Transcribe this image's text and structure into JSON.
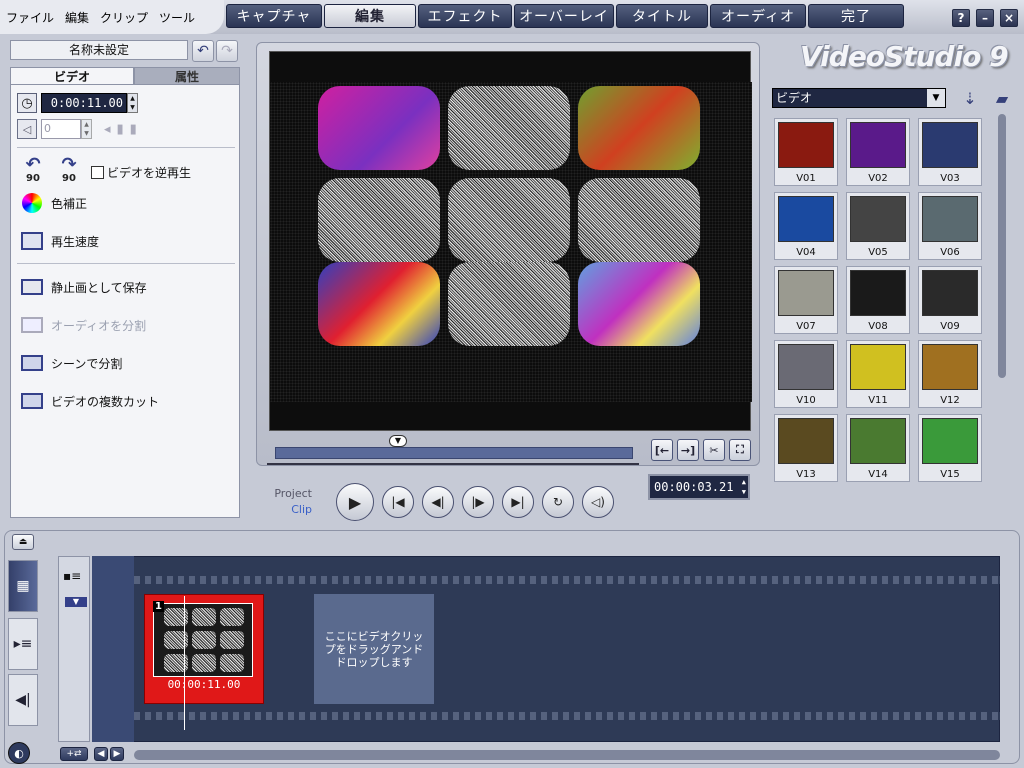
{
  "menu": [
    "ファイル",
    "編集",
    "クリップ",
    "ツール"
  ],
  "tabs": [
    {
      "label": "キャプチャ",
      "active": false
    },
    {
      "label": "編集",
      "active": true
    },
    {
      "label": "エフェクト",
      "active": false
    },
    {
      "label": "オーバーレイ",
      "active": false
    },
    {
      "label": "タイトル",
      "active": false
    },
    {
      "label": "オーディオ",
      "active": false
    },
    {
      "label": "完了",
      "active": false
    }
  ],
  "window_controls": [
    "?",
    "–",
    "×"
  ],
  "project_name": "名称未設定",
  "panel_tabs": {
    "video": "ビデオ",
    "attributes": "属性"
  },
  "options": {
    "duration": "0:00:11.00",
    "volume_value": "0",
    "rotate_left_label": "90",
    "rotate_right_label": "90",
    "reverse_label": "ビデオを逆再生",
    "reverse_checked": false,
    "color_correction": "色補正",
    "playback_speed": "再生速度",
    "save_still": "静止画として保存",
    "split_audio": "オーディオを分割",
    "split_by_scene": "シーンで分割",
    "multi_trim": "ビデオの複数カット"
  },
  "preview": {
    "project_label": "Project",
    "clip_label": "Clip",
    "timecode": "00:00:03.21"
  },
  "library": {
    "logo": "VideoStudio 9",
    "category": "ビデオ",
    "items": [
      {
        "label": "V01",
        "color": "#8a1a10"
      },
      {
        "label": "V02",
        "color": "#5a1a8a"
      },
      {
        "label": "V03",
        "color": "#2a3a70"
      },
      {
        "label": "V04",
        "color": "#1a4aa0"
      },
      {
        "label": "V05",
        "color": "#444444"
      },
      {
        "label": "V06",
        "color": "#5a6a70"
      },
      {
        "label": "V07",
        "color": "#9a9a90"
      },
      {
        "label": "V08",
        "color": "#1a1a1a"
      },
      {
        "label": "V09",
        "color": "#2a2a2a"
      },
      {
        "label": "V10",
        "color": "#6a6a74"
      },
      {
        "label": "V11",
        "color": "#d0c020"
      },
      {
        "label": "V12",
        "color": "#a07020"
      },
      {
        "label": "V13",
        "color": "#5a4a20"
      },
      {
        "label": "V14",
        "color": "#4a7a30"
      },
      {
        "label": "V15",
        "color": "#3a9a3a"
      }
    ]
  },
  "timeline": {
    "clip_number": "1",
    "clip_duration": "00:00:11.00",
    "drop_hint": "ここにビデオクリップをドラッグアンドドロップします"
  }
}
